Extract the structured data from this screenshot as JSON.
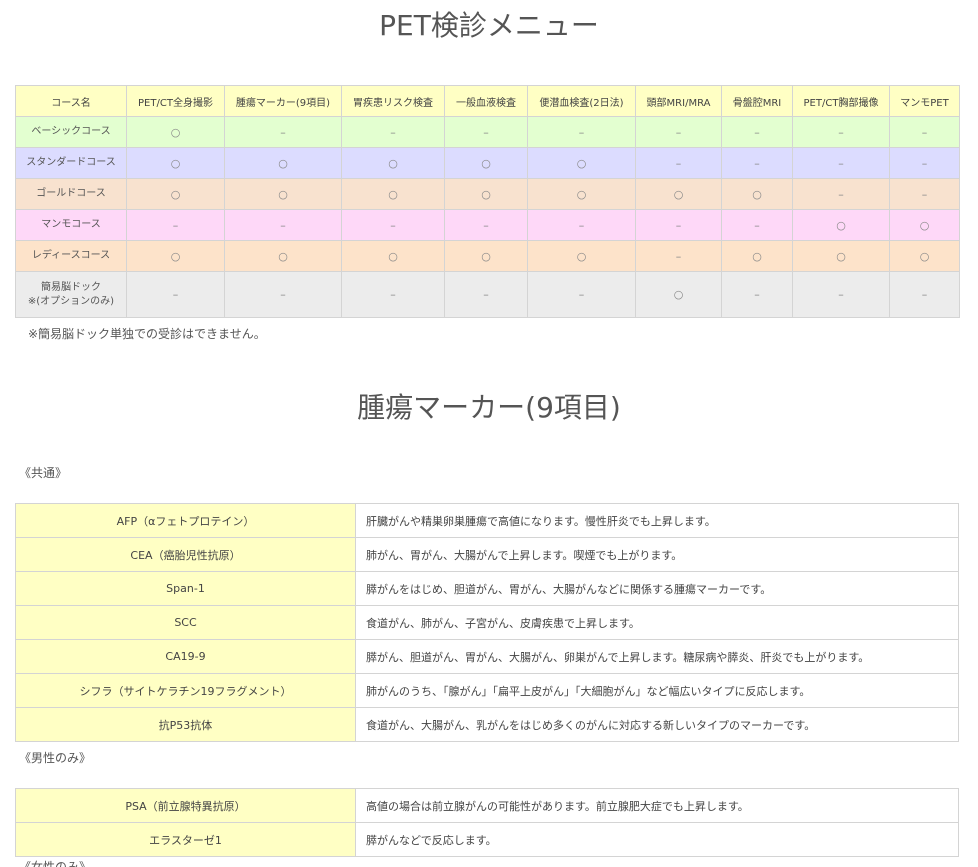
{
  "title1": "PET検診メニュー",
  "course_table": {
    "headers": [
      "コース名",
      "PET/CT全身撮影",
      "腫瘍マーカー(9項目)",
      "胃疾患リスク検査",
      "一般血液検査",
      "便潜血検査(2日法)",
      "頭部MRI/MRA",
      "骨盤腔MRI",
      "PET/CT胸部撮像",
      "マンモPET"
    ],
    "rows": [
      {
        "name": "ベーシックコース",
        "color": "#e3ffd0",
        "cells": [
          "○",
          "–",
          "–",
          "–",
          "–",
          "–",
          "–",
          "–",
          "–"
        ]
      },
      {
        "name": "スタンダードコース",
        "color": "#dcdcff",
        "cells": [
          "○",
          "○",
          "○",
          "○",
          "○",
          "–",
          "–",
          "–",
          "–"
        ]
      },
      {
        "name": "ゴールドコース",
        "color": "#f8e2cf",
        "cells": [
          "○",
          "○",
          "○",
          "○",
          "○",
          "○",
          "○",
          "–",
          "–"
        ]
      },
      {
        "name": "マンモコース",
        "color": "#fed8f8",
        "cells": [
          "–",
          "–",
          "–",
          "–",
          "–",
          "–",
          "–",
          "○",
          "○"
        ]
      },
      {
        "name": "レディースコース",
        "color": "#fde3ca",
        "cells": [
          "○",
          "○",
          "○",
          "○",
          "○",
          "–",
          "○",
          "○",
          "○"
        ]
      },
      {
        "name": "簡易脳ドック\n※(オプションのみ)",
        "color": "#ececec",
        "cells": [
          "–",
          "–",
          "–",
          "–",
          "–",
          "○",
          "–",
          "–",
          "–"
        ]
      }
    ]
  },
  "note": "※簡易脳ドック単独での受診はできません。",
  "title2": "腫瘍マーカー(9項目)",
  "sections": {
    "common": "《共通》",
    "male": "《男性のみ》",
    "female": "《女性のみ》"
  },
  "markers_common": [
    {
      "name": "AFP（αフェトプロテイン）",
      "desc": "肝臓がんや精巣卵巣腫瘍で高値になります。慢性肝炎でも上昇します。"
    },
    {
      "name": "CEA（癌胎児性抗原）",
      "desc": "肺がん、胃がん、大腸がんで上昇します。喫煙でも上がります。"
    },
    {
      "name": "Span-1",
      "desc": "膵がんをはじめ、胆道がん、胃がん、大腸がんなどに関係する腫瘍マーカーです。"
    },
    {
      "name": "SCC",
      "desc": "食道がん、肺がん、子宮がん、皮膚疾患で上昇します。"
    },
    {
      "name": "CA19-9",
      "desc": "膵がん、胆道がん、胃がん、大腸がん、卵巣がんで上昇します。糖尿病や膵炎、肝炎でも上がります。"
    },
    {
      "name": "シフラ（サイトケラチン19フラグメント）",
      "desc": "肺がんのうち、「腺がん」「扁平上皮がん」「大細胞がん」など幅広いタイプに反応します。"
    },
    {
      "name": "抗P53抗体",
      "desc": "食道がん、大腸がん、乳がんをはじめ多くのがんに対応する新しいタイプのマーカーです。"
    }
  ],
  "markers_male": [
    {
      "name": "PSA（前立腺特異抗原）",
      "desc": "高値の場合は前立腺がんの可能性があります。前立腺肥大症でも上昇します。"
    },
    {
      "name": "エラスターゼ1",
      "desc": "膵がんなどで反応します。"
    }
  ]
}
